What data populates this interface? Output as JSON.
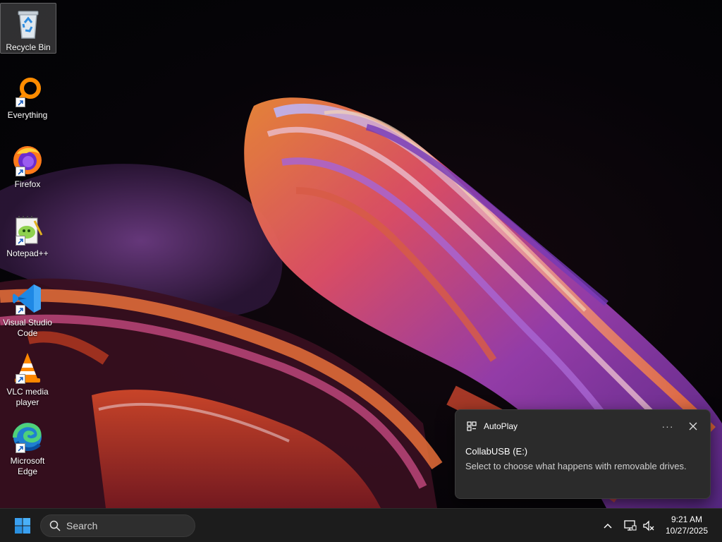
{
  "desktop": {
    "icons": [
      {
        "label": "Recycle Bin",
        "icon": "recycle-bin-icon",
        "selected": true
      },
      {
        "label": "Everything",
        "icon": "everything-search-icon"
      },
      {
        "label": "Firefox",
        "icon": "firefox-icon"
      },
      {
        "label": "Notepad++",
        "icon": "notepad-plus-plus-icon"
      },
      {
        "label": "Visual Studio Code",
        "icon": "vscode-icon"
      },
      {
        "label": "VLC media player",
        "icon": "vlc-icon"
      },
      {
        "label": "Microsoft Edge",
        "icon": "edge-icon"
      }
    ]
  },
  "toast": {
    "app_name": "AutoPlay",
    "more_label": "···",
    "title": "CollabUSB (E:)",
    "body": "Select to choose what happens with removable drives."
  },
  "taskbar": {
    "search_placeholder": "Search",
    "tray": {
      "show_hidden_icon": "chevron-up-icon",
      "network_icon": "network-icon",
      "volume_icon": "volume-muted-icon"
    },
    "clock": {
      "time": "9:21 AM",
      "date": "10/27/2025"
    }
  },
  "colors": {
    "taskbar_bg": "#1c1c1c",
    "toast_bg": "#2b2b2b",
    "start_blue": "#3aa0f0"
  }
}
